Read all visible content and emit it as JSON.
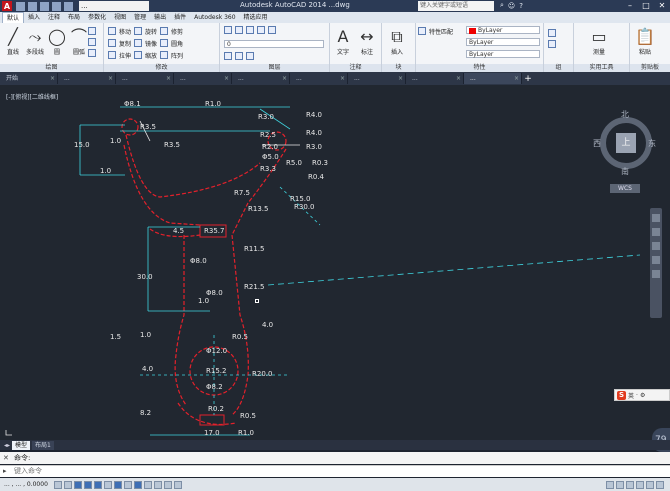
{
  "title_bar": {
    "app_logo": "A",
    "workspace_hint": "...",
    "title": "Autodesk AutoCAD 2014 ...dwg",
    "search_placeholder": "键入关键字或短语"
  },
  "ribbon_tabs": [
    "默认",
    "插入",
    "注释",
    "布局",
    "参数化",
    "视图",
    "管理",
    "输出",
    "插件",
    "Autodesk 360",
    "精选应用"
  ],
  "ribbon_panels": {
    "draw": {
      "title": "绘图",
      "line": "直线",
      "polyline": "多段线",
      "circle": "圆",
      "arc": "圆弧"
    },
    "modify": {
      "title": "修改",
      "items": [
        "移动",
        "旋转",
        "修剪",
        "复制",
        "镜像",
        "圆角",
        "拉伸",
        "缩放",
        "阵列"
      ]
    },
    "layers": {
      "title": "图层"
    },
    "annotation": {
      "title": "注释",
      "text": "文字",
      "dim": "标注"
    },
    "block": {
      "title": "块",
      "insert": "插入"
    },
    "properties": {
      "title": "特性",
      "bylayer": "ByLayer",
      "match": "特性匹配"
    },
    "groups": {
      "title": "组"
    },
    "utilities": {
      "title": "实用工具",
      "measure": "测量"
    },
    "clipboard": {
      "title": "剪贴板",
      "paste": "粘贴"
    }
  },
  "colors": {
    "accent_red": "#c4141c",
    "cad_background": "#212730",
    "dimension_cyan": "#3fd5e0",
    "geometry_red": "#e3212b",
    "geometry_white": "#e8e8e8"
  },
  "file_tabs": [
    {
      "label": "开始",
      "active": false
    },
    {
      "label": "...",
      "active": false
    },
    {
      "label": "...",
      "active": false
    },
    {
      "label": "...",
      "active": false
    },
    {
      "label": "...",
      "active": false
    },
    {
      "label": "...",
      "active": false
    },
    {
      "label": "...",
      "active": false
    },
    {
      "label": "...",
      "active": false
    },
    {
      "label": "...",
      "active": true
    }
  ],
  "viewport_label": "[-][俯视][二维线框]",
  "viewcube": {
    "north": "北",
    "south": "南",
    "east": "东",
    "west": "西",
    "top_face": "上",
    "wcs": "WCS"
  },
  "dimensions": [
    {
      "id": "d1",
      "text": "Φ8.1"
    },
    {
      "id": "d2",
      "text": "R1.0"
    },
    {
      "id": "d3",
      "text": "R3.0"
    },
    {
      "id": "d4",
      "text": "R4.0"
    },
    {
      "id": "d5",
      "text": "R3.5"
    },
    {
      "id": "d6",
      "text": "R4.0"
    },
    {
      "id": "d7",
      "text": "R2.5"
    },
    {
      "id": "d8",
      "text": "R2.0"
    },
    {
      "id": "d9",
      "text": "R3.0"
    },
    {
      "id": "d10",
      "text": "Φ5.0"
    },
    {
      "id": "d11",
      "text": "R0.3"
    },
    {
      "id": "d12",
      "text": "R3.3"
    },
    {
      "id": "d13",
      "text": "R5.0"
    },
    {
      "id": "d14",
      "text": "R0.4"
    },
    {
      "id": "d15",
      "text": "15.0"
    },
    {
      "id": "d16",
      "text": "1.0"
    },
    {
      "id": "d17",
      "text": "1.0"
    },
    {
      "id": "d18",
      "text": "R3.5"
    },
    {
      "id": "d19",
      "text": "R7.5"
    },
    {
      "id": "d20",
      "text": "R15.0"
    },
    {
      "id": "d21",
      "text": "R13.5"
    },
    {
      "id": "d22",
      "text": "R30.0"
    },
    {
      "id": "d23",
      "text": "R35.7"
    },
    {
      "id": "d24",
      "text": "R11.5"
    },
    {
      "id": "d25",
      "text": "Φ8.0"
    },
    {
      "id": "d26",
      "text": "R21.5"
    },
    {
      "id": "d27",
      "text": "30.0"
    },
    {
      "id": "d28",
      "text": "Φ8.0"
    },
    {
      "id": "d29",
      "text": "4.0"
    },
    {
      "id": "d30",
      "text": "R0.5"
    },
    {
      "id": "d31",
      "text": "1.5"
    },
    {
      "id": "d32",
      "text": "R15.2"
    },
    {
      "id": "d33",
      "text": "R20.0"
    },
    {
      "id": "d34",
      "text": "Φ12.0"
    },
    {
      "id": "d35",
      "text": "Φ8.2"
    },
    {
      "id": "d36",
      "text": "R0.2"
    },
    {
      "id": "d37",
      "text": "R0.5"
    },
    {
      "id": "d38",
      "text": "17.0"
    },
    {
      "id": "d39",
      "text": "R1.0"
    },
    {
      "id": "d40",
      "text": "8.2"
    },
    {
      "id": "d41",
      "text": "1.0"
    },
    {
      "id": "d42",
      "text": "4.0"
    },
    {
      "id": "d43",
      "text": "4.5"
    },
    {
      "id": "d44",
      "text": "1.0"
    }
  ],
  "layout_tabs": [
    {
      "label": "模型",
      "active": true
    },
    {
      "label": "布局1",
      "active": false
    }
  ],
  "command_history": "命令:",
  "command_placeholder": "键入命令",
  "ime": {
    "lang": "英"
  },
  "zoom_label": "79",
  "status": {
    "coords": "... , ... , 0.0000"
  }
}
